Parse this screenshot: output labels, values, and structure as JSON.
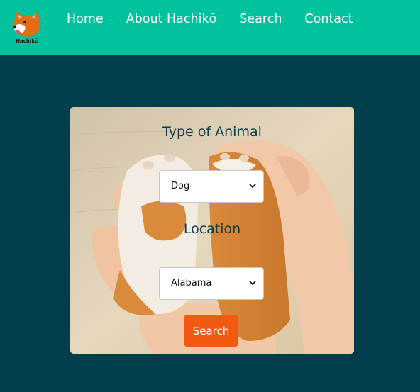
{
  "brand": {
    "logo_text": "Hachikō",
    "icon": "shiba-dog-logo"
  },
  "nav": {
    "items": [
      {
        "label": "Home"
      },
      {
        "label": "About Hachikō"
      },
      {
        "label": "Search"
      },
      {
        "label": "Contact"
      }
    ]
  },
  "form": {
    "animal_label": "Type of Animal",
    "animal_selected": "Dog",
    "location_label": "Location",
    "location_selected": "Alabama",
    "search_label": "Search"
  },
  "colors": {
    "navbar": "#00c39e",
    "page_background": "#013e4b",
    "button": "#f15a10",
    "heading_text": "#0f3c45"
  }
}
